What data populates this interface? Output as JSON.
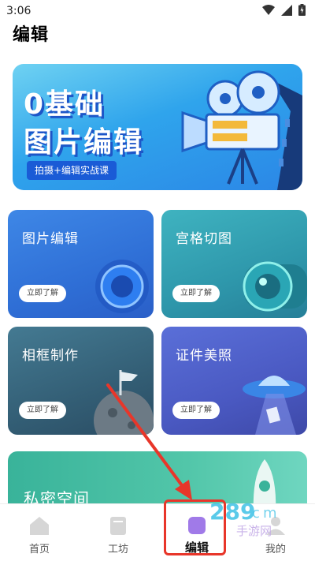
{
  "status_bar": {
    "time": "3:06"
  },
  "page": {
    "title": "编辑"
  },
  "banner": {
    "line1": "0基础",
    "line2": "图片编辑",
    "tag": "拍摄+编辑实战课"
  },
  "cards": [
    {
      "title": "图片编辑",
      "button": "立即了解"
    },
    {
      "title": "宫格切图",
      "button": "立即了解"
    },
    {
      "title": "相框制作",
      "button": "立即了解"
    },
    {
      "title": "证件美照",
      "button": "立即了解"
    }
  ],
  "wide_card": {
    "title": "私密空间"
  },
  "tabs": [
    {
      "label": "首页",
      "icon": "home-icon"
    },
    {
      "label": "工坊",
      "icon": "book-icon"
    },
    {
      "label": "编辑",
      "icon": "edit-icon"
    },
    {
      "label": "我的",
      "icon": "profile-icon"
    }
  ],
  "watermark": {
    "text": "289手游网"
  },
  "colors": {
    "annotation": "#e8362a",
    "banner": "#2fa4ec"
  }
}
